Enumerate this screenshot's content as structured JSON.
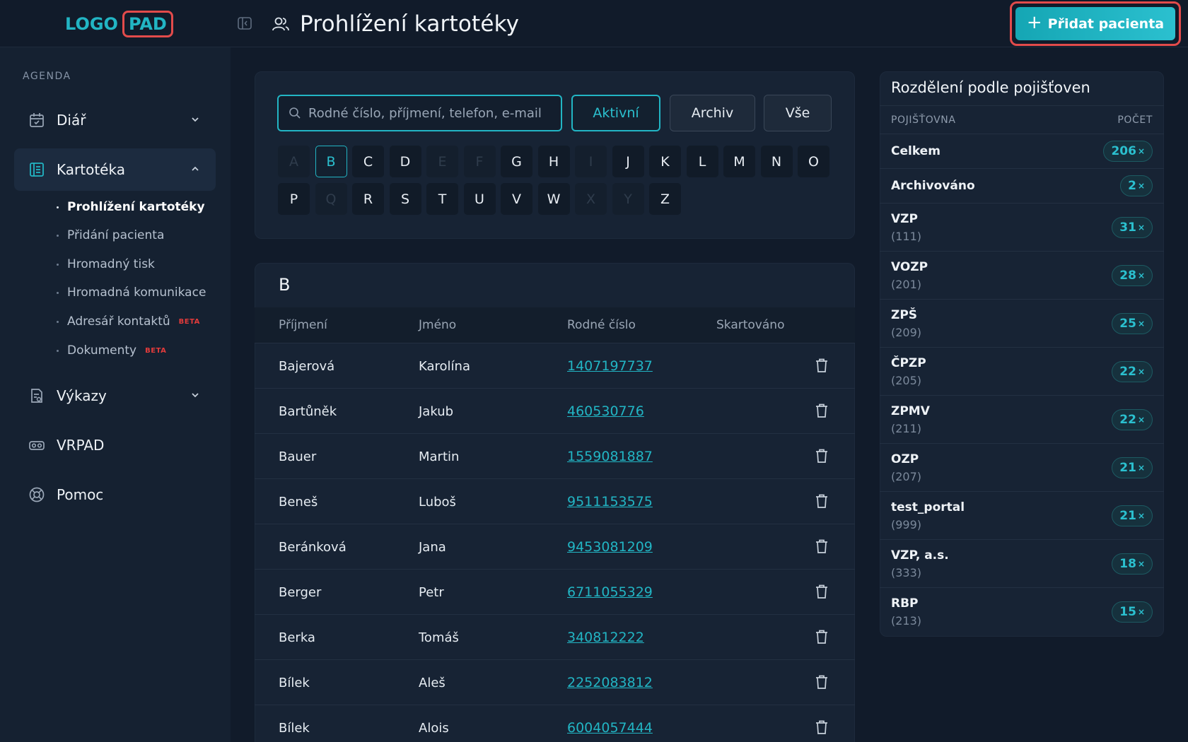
{
  "logo": {
    "part1": "LOGO",
    "part2": "PAD"
  },
  "header": {
    "title": "Prohlížení kartotéky",
    "add_button": "Přidat pacienta"
  },
  "sidebar": {
    "section": "AGENDA",
    "items": [
      {
        "label": "Diář",
        "icon": "calendar-icon"
      },
      {
        "label": "Kartotéka",
        "icon": "card-file-icon"
      },
      {
        "label": "Výkazy",
        "icon": "report-icon"
      },
      {
        "label": "VRPAD",
        "icon": "vr-headset-icon"
      },
      {
        "label": "Pomoc",
        "icon": "lifebuoy-icon"
      }
    ],
    "sub_items": [
      {
        "label": "Prohlížení kartotéky",
        "beta": ""
      },
      {
        "label": "Přidání pacienta",
        "beta": ""
      },
      {
        "label": "Hromadný tisk",
        "beta": ""
      },
      {
        "label": "Hromadná komunikace",
        "beta": ""
      },
      {
        "label": "Adresář kontaktů",
        "beta": "BETA"
      },
      {
        "label": "Dokumenty",
        "beta": "BETA"
      }
    ]
  },
  "search": {
    "placeholder": "Rodné číslo, příjmení, telefon, e-mail",
    "filters": [
      "Aktivní",
      "Archiv",
      "Vše"
    ],
    "active_filter": "Aktivní"
  },
  "letters": {
    "row1": [
      "A",
      "B",
      "C",
      "D",
      "E",
      "F",
      "G",
      "H",
      "I",
      "J",
      "K",
      "L",
      "M",
      "N",
      "O"
    ],
    "row2": [
      "P",
      "Q",
      "R",
      "S",
      "T",
      "U",
      "V",
      "W",
      "X",
      "Y",
      "Z"
    ],
    "disabled": [
      "A",
      "E",
      "F",
      "I",
      "Q",
      "X",
      "Y"
    ],
    "active": "B"
  },
  "table": {
    "section_letter": "B",
    "columns": [
      "Příjmení",
      "Jméno",
      "Rodné číslo",
      "Skartováno"
    ],
    "rows": [
      {
        "surname": "Bajerová",
        "name": "Karolína",
        "id": "1407197737"
      },
      {
        "surname": "Bartůněk",
        "name": "Jakub",
        "id": "460530776"
      },
      {
        "surname": "Bauer",
        "name": "Martin",
        "id": "1559081887"
      },
      {
        "surname": "Beneš",
        "name": "Luboš",
        "id": "9511153575"
      },
      {
        "surname": "Beránková",
        "name": "Jana",
        "id": "9453081209"
      },
      {
        "surname": "Berger",
        "name": "Petr",
        "id": "6711055329"
      },
      {
        "surname": "Berka",
        "name": "Tomáš",
        "id": "340812222"
      },
      {
        "surname": "Bílek",
        "name": "Aleš",
        "id": "2252083812"
      },
      {
        "surname": "Bílek",
        "name": "Alois",
        "id": "6004057444"
      }
    ]
  },
  "insurers": {
    "title": "Rozdělení podle pojišťoven",
    "col_name": "POJIŠŤOVNA",
    "col_count": "POČET",
    "rows": [
      {
        "name": "Celkem",
        "code": "",
        "count": "206"
      },
      {
        "name": "Archivováno",
        "code": "",
        "count": "2"
      },
      {
        "name": "VZP",
        "code": "(111)",
        "count": "31"
      },
      {
        "name": "VOZP",
        "code": "(201)",
        "count": "28"
      },
      {
        "name": "ZPŠ",
        "code": "(209)",
        "count": "25"
      },
      {
        "name": "ČPZP",
        "code": "(205)",
        "count": "22"
      },
      {
        "name": "ZPMV",
        "code": "(211)",
        "count": "22"
      },
      {
        "name": "OZP",
        "code": "(207)",
        "count": "21"
      },
      {
        "name": "test_portal",
        "code": "(999)",
        "count": "21"
      },
      {
        "name": "VZP, a.s.",
        "code": "(333)",
        "count": "18"
      },
      {
        "name": "RBP",
        "code": "(213)",
        "count": "15"
      }
    ],
    "badge_suffix": "×"
  },
  "colors": {
    "accent": "#22b5c4",
    "highlight": "#e24b4b",
    "background": "#111b2a"
  }
}
